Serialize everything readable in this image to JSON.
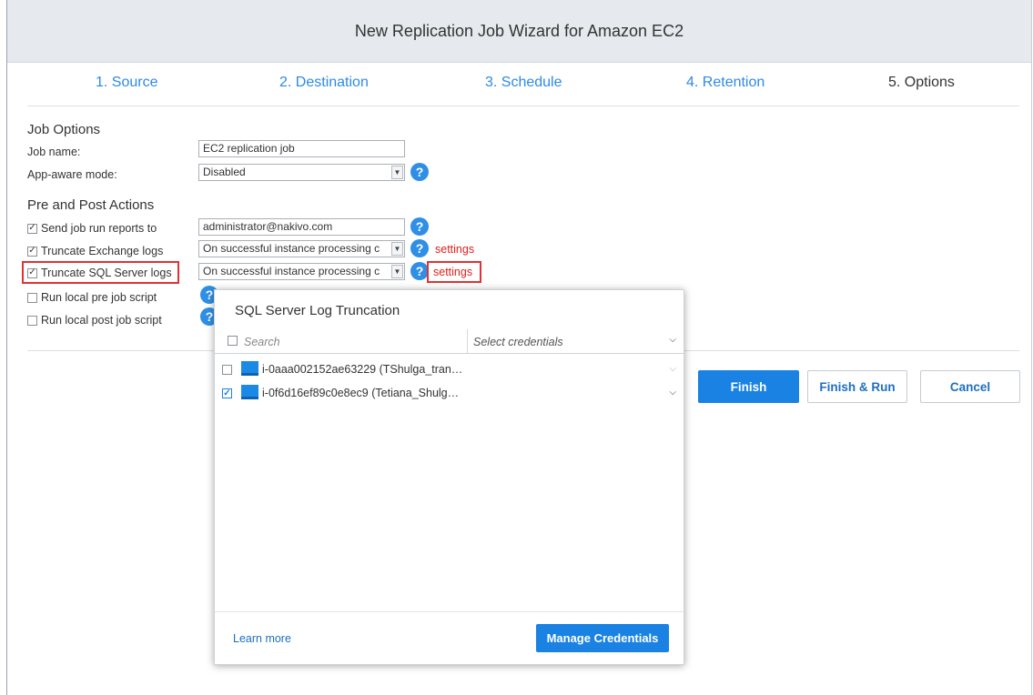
{
  "window": {
    "title": "New Replication Job Wizard for Amazon EC2"
  },
  "steps": [
    {
      "label": "1. Source"
    },
    {
      "label": "2. Destination"
    },
    {
      "label": "3. Schedule"
    },
    {
      "label": "4. Retention"
    },
    {
      "label": "5. Options",
      "active": true
    }
  ],
  "job_options": {
    "title": "Job Options",
    "job_name_label": "Job name:",
    "job_name_value": "EC2 replication job",
    "app_aware_label": "App-aware mode:",
    "app_aware_value": "Disabled"
  },
  "pre_post": {
    "title": "Pre and Post Actions",
    "send_reports": {
      "label": "Send job run reports to",
      "checked": true,
      "value": "administrator@nakivo.com"
    },
    "truncate_exchange": {
      "label": "Truncate Exchange logs",
      "checked": true,
      "value": "On successful instance processing c",
      "settings": "settings"
    },
    "truncate_sql": {
      "label": "Truncate SQL Server logs",
      "checked": true,
      "value": "On successful instance processing c",
      "settings": "settings"
    },
    "pre_script": {
      "label": "Run local pre job script",
      "checked": false
    },
    "post_script": {
      "label": "Run local post job script",
      "checked": false
    }
  },
  "buttons": {
    "finish": "Finish",
    "finish_run": "Finish & Run",
    "cancel": "Cancel"
  },
  "popup": {
    "title": "SQL Server Log Truncation",
    "search_placeholder": "Search",
    "credentials_placeholder": "Select credentials",
    "items": [
      {
        "name": "i-0aaa002152ae63229 (TShulga_tran…",
        "checked": false
      },
      {
        "name": "i-0f6d16ef89c0e8ec9 (Tetiana_Shulg…",
        "checked": true
      }
    ],
    "learn_more": "Learn more",
    "manage_credentials": "Manage Credentials"
  },
  "icons": {
    "help": "?",
    "check": "✓",
    "dropdown": "⌄"
  },
  "colors": {
    "accent": "#1a82e2",
    "link": "#2d8ae6",
    "warning": "#e0201b"
  }
}
